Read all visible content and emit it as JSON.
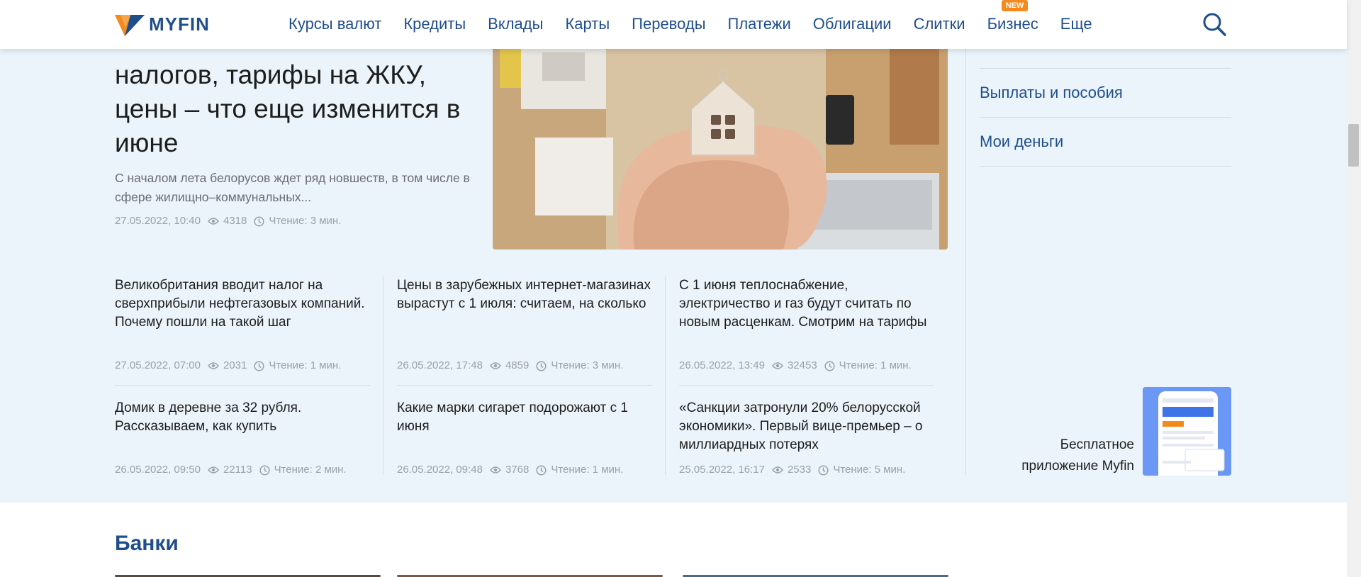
{
  "header": {
    "logo_text": "MYFIN",
    "nav": [
      {
        "label": "Курсы валют"
      },
      {
        "label": "Кредиты"
      },
      {
        "label": "Вклады"
      },
      {
        "label": "Карты"
      },
      {
        "label": "Переводы"
      },
      {
        "label": "Платежи"
      },
      {
        "label": "Облигации"
      },
      {
        "label": "Слитки"
      },
      {
        "label": "Бизнес",
        "badge": "NEW"
      },
      {
        "label": "Еще"
      }
    ],
    "search_icon": "search-icon"
  },
  "main_article": {
    "title_line_1": "налогов, тарифы на ЖКУ,",
    "title_line_2": "цены – что еще изменится в",
    "title_line_3": "июне",
    "description": "С началом лета белорусов ждет ряд новшеств, в том числе в сфере жилищно–коммунальных...",
    "date": "27.05.2022, 10:40",
    "views": "4318",
    "reading": "Чтение: 3 мин."
  },
  "articles": [
    {
      "title": "Великобритания вводит налог на сверхприбыли нефтегазовых компаний. Почему пошли на такой шаг",
      "date": "27.05.2022, 07:00",
      "views": "2031",
      "reading": "Чтение: 1 мин."
    },
    {
      "title": "Цены в зарубежных интернет-магазинах вырастут с 1 июля: считаем, на сколько",
      "date": "26.05.2022, 17:48",
      "views": "4859",
      "reading": "Чтение: 3 мин."
    },
    {
      "title": "С 1 июня теплоснабжение, электричество и газ будут считать по новым расценкам. Смотрим на тарифы",
      "date": "26.05.2022, 13:49",
      "views": "32453",
      "reading": "Чтение: 1 мин."
    },
    {
      "title": "Домик в деревне за 32 рубля. Рассказываем, как купить",
      "date": "26.05.2022, 09:50",
      "views": "22113",
      "reading": "Чтение: 2 мин."
    },
    {
      "title": "Какие марки сигарет подорожают с 1 июня",
      "date": "26.05.2022, 09:48",
      "views": "3768",
      "reading": "Чтение: 1 мин."
    },
    {
      "title": "«Санкции затронули 20% белорусской экономики». Первый вице-премьер – о миллиардных потерях",
      "date": "25.05.2022, 16:17",
      "views": "2533",
      "reading": "Чтение: 5 мин."
    }
  ],
  "sidebar": {
    "links": [
      {
        "label": "Выплаты и пособия"
      },
      {
        "label": "Мои деньги"
      }
    ],
    "promo_text": "Бесплатное приложение Myfin"
  },
  "banks_section": {
    "title": "Банки"
  },
  "colors": {
    "brand_blue": "#1f4e8c",
    "brand_orange": "#f28a1c",
    "news_background": "#eaf4fa"
  }
}
